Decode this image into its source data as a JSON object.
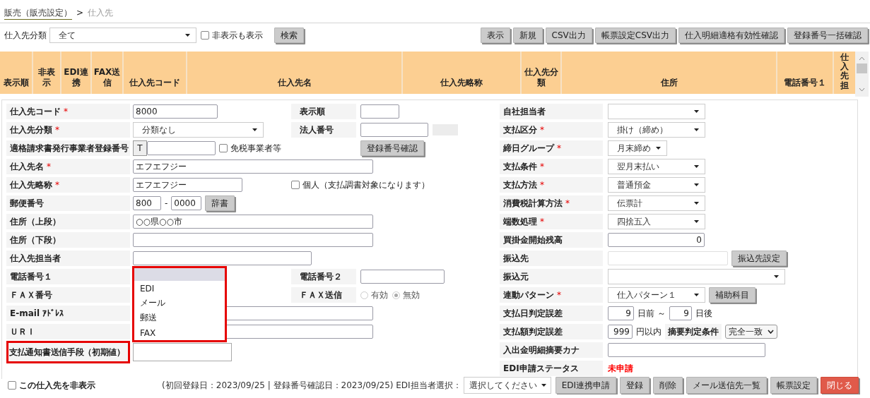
{
  "breadcrumb": {
    "link": "販売（販売設定）",
    "separator": ">",
    "current": "仕入先"
  },
  "filter": {
    "label": "仕入先分類",
    "value": "全て",
    "show_hidden": {
      "label": "非表示も表示",
      "checked": false
    },
    "search_button": "検索"
  },
  "toolbar_buttons": [
    "表示",
    "新規",
    "CSV出力",
    "帳票設定CSV出力",
    "仕入明細適格有効性確認",
    "登録番号一括確認"
  ],
  "table": {
    "columns": [
      "表示順",
      "非表示",
      "EDI連携",
      "FAX送信",
      "仕入先コード",
      "仕入先名",
      "仕入先略称",
      "仕入先分類",
      "住所",
      "電話番号１",
      "仕入先担"
    ]
  },
  "form": {
    "left_rows": [
      {
        "label": "仕入先コード",
        "required_mark": "*",
        "highlighted": false,
        "fields": [
          {
            "kind": "input",
            "value": "8000"
          }
        ],
        "side": {
          "label": "表示順",
          "fields": [
            {
              "kind": "input"
            }
          ]
        }
      },
      {
        "label": "仕入先分類",
        "required_mark": "*",
        "highlighted": false,
        "fields": [
          {
            "kind": "select",
            "value": "分類なし"
          }
        ],
        "side": {
          "label": "法人番号",
          "fields": [
            {
              "kind": "input"
            },
            {
              "kind": "blank"
            }
          ]
        }
      },
      {
        "label": "適格請求書発行事業者登録番号",
        "highlighted": false,
        "fields": [
          {
            "kind": "addon",
            "text": "T"
          },
          {
            "kind": "input"
          },
          {
            "kind": "checkbox",
            "label": "免税事業者等",
            "checked": false
          }
        ],
        "side": {
          "fields": [
            {
              "kind": "button",
              "label": "登録番号確認"
            }
          ]
        }
      },
      {
        "label": "仕入先名",
        "required_mark": "*",
        "highlighted": false,
        "fields": [
          {
            "kind": "input",
            "value": "エフエフジー"
          }
        ]
      },
      {
        "label": "仕入先略称",
        "required_mark": "*",
        "highlighted": false,
        "fields": [
          {
            "kind": "input",
            "value": "エフエフジー"
          }
        ],
        "side": {
          "fields": [
            {
              "kind": "checkbox",
              "label": "個人（支払調書対象になります）",
              "checked": false
            }
          ]
        }
      },
      {
        "label": "郵便番号",
        "highlighted": false,
        "fields": [
          {
            "kind": "input",
            "value": "800"
          },
          {
            "kind": "text",
            "text": "-"
          },
          {
            "kind": "input",
            "value": "0000"
          },
          {
            "kind": "button",
            "label": "辞書"
          }
        ]
      },
      {
        "label": "住所（上段）",
        "highlighted": false,
        "fields": [
          {
            "kind": "input",
            "value": "○○県○○市"
          }
        ]
      },
      {
        "label": "住所（下段）",
        "highlighted": false,
        "fields": [
          {
            "kind": "input"
          }
        ]
      },
      {
        "label": "仕入先担当者",
        "highlighted": false,
        "fields": [
          {
            "kind": "input"
          }
        ]
      },
      {
        "label": "電話番号１",
        "highlighted": false,
        "side": {
          "label": "電話番号２",
          "fields": [
            {
              "kind": "input"
            }
          ]
        }
      },
      {
        "label": "ＦＡＸ番号",
        "highlighted": false,
        "side": {
          "label": "ＦＡＸ送信",
          "fields": [
            {
              "kind": "radio",
              "label": "有効",
              "selected": false
            },
            {
              "kind": "radio",
              "label": "無効",
              "selected": true
            }
          ]
        }
      },
      {
        "label": "E-mail ｱﾄﾞﾚｽ",
        "highlighted": false,
        "fields": [
          {
            "kind": "input"
          }
        ]
      },
      {
        "label": "ＵＲＩ",
        "highlighted": false,
        "fields": [
          {
            "kind": "input"
          }
        ]
      },
      {
        "label": "支払通知書送信手段（初期値）",
        "highlighted": true,
        "fields": [
          {
            "kind": "select",
            "open": true,
            "highlighted": true,
            "options": [
              {
                "selected": true
              },
              {
                "label": "EDI",
                "selected": false
              },
              {
                "label": "メール",
                "selected": false
              },
              {
                "label": "郵送",
                "selected": false
              },
              {
                "label": "FAX",
                "selected": false
              }
            ]
          }
        ]
      }
    ],
    "right_rows": [
      {
        "label": "自社担当者",
        "fields": [
          {
            "kind": "select"
          }
        ]
      },
      {
        "label": "支払区分",
        "required_mark": "*",
        "fields": [
          {
            "kind": "select",
            "value": "掛け（締め）"
          }
        ]
      },
      {
        "label": "締日グループ",
        "required_mark": "*",
        "fields": [
          {
            "kind": "select",
            "value": "月末締め"
          }
        ]
      },
      {
        "label": "支払条件",
        "required_mark": "*",
        "fields": [
          {
            "kind": "select",
            "value": "翌月末払い"
          }
        ]
      },
      {
        "label": "支払方法",
        "required_mark": "*",
        "fields": [
          {
            "kind": "select",
            "value": "普通預金"
          }
        ]
      },
      {
        "label": "消費税計算方法",
        "required_mark": "*",
        "fields": [
          {
            "kind": "select",
            "value": "伝票計"
          }
        ]
      },
      {
        "label": "端数処理",
        "required_mark": "*",
        "fields": [
          {
            "kind": "select",
            "value": "四捨五入"
          }
        ]
      },
      {
        "label": "買掛金開始残高",
        "fields": [
          {
            "kind": "number",
            "value": "0"
          }
        ]
      },
      {
        "label": "振込先",
        "fields": [
          {
            "kind": "readonly"
          },
          {
            "kind": "button",
            "label": "振込先設定"
          }
        ]
      },
      {
        "label": "振込元",
        "fields": [
          {
            "kind": "select"
          }
        ]
      },
      {
        "label": "連動パターン",
        "required_mark": "*",
        "fields": [
          {
            "kind": "select",
            "value": "仕入パターン１"
          },
          {
            "kind": "button",
            "label": "補助科目"
          }
        ]
      },
      {
        "label": "支払日判定誤差",
        "fields": [
          {
            "kind": "number",
            "value": "9"
          },
          {
            "kind": "text",
            "text": "日前 ～"
          },
          {
            "kind": "number",
            "value": "9"
          },
          {
            "kind": "text",
            "text": "日後"
          }
        ]
      },
      {
        "label": "支払額判定誤差",
        "fields": [
          {
            "kind": "number",
            "value": "999"
          },
          {
            "kind": "text",
            "text": "円以内"
          },
          {
            "kind": "label",
            "text": "摘要判定条件"
          },
          {
            "kind": "native-select",
            "value": "完全一致"
          }
        ]
      },
      {
        "label": "入出金明細摘要カナ",
        "fields": [
          {
            "kind": "input"
          }
        ]
      },
      {
        "label": "EDI申請ステータス",
        "fields": [
          {
            "kind": "status",
            "text": "未申請"
          }
        ]
      }
    ]
  },
  "footer": {
    "hide_checkbox": {
      "label": "この仕入先を非表示",
      "checked": false
    },
    "info": "(初回登録日：2023/09/25 | 登録番号確認日：2023/09/25) EDI担当者選択：",
    "edi_select": "選択してください",
    "buttons": [
      {
        "label": "EDI連携申請",
        "kind": "normal"
      },
      {
        "label": "登録",
        "kind": "normal"
      },
      {
        "label": "削除",
        "kind": "normal"
      },
      {
        "label": "メール送信先一覧",
        "kind": "normal"
      },
      {
        "label": "帳票設定",
        "kind": "normal"
      },
      {
        "label": "閉じる",
        "kind": "danger"
      }
    ]
  }
}
